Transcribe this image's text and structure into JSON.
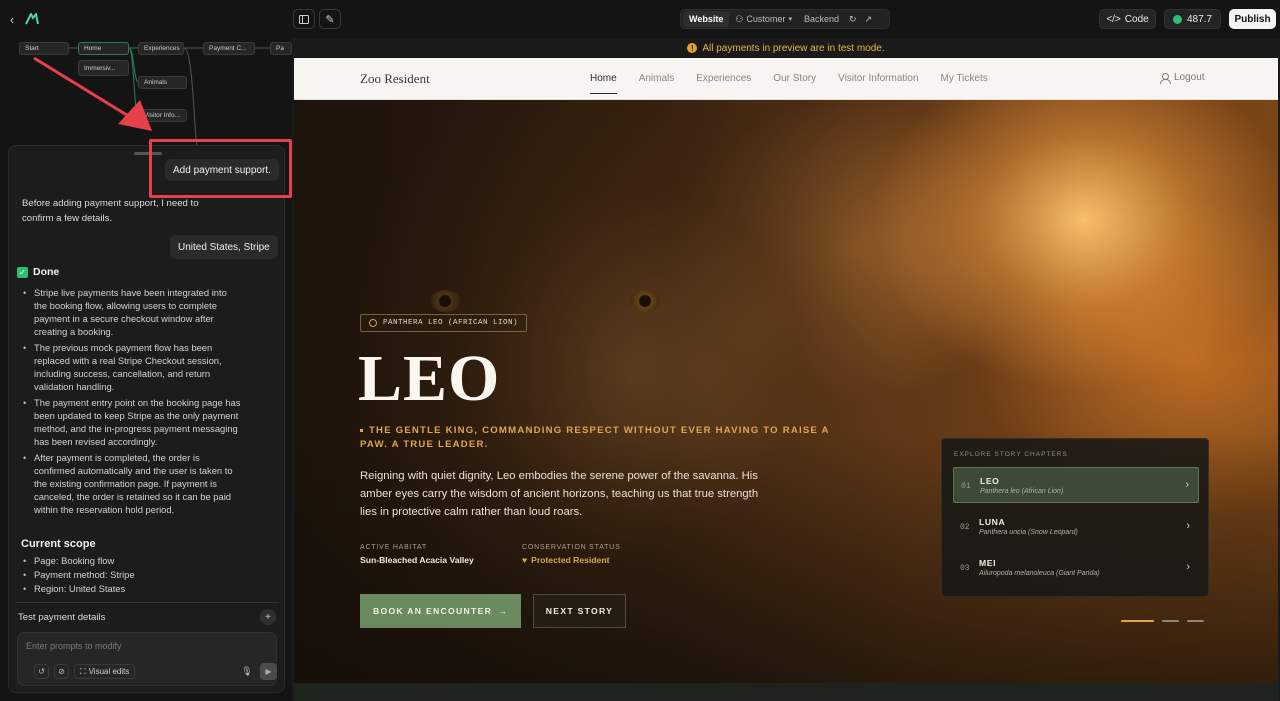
{
  "topbar": {
    "seg_website": "Website",
    "seg_customer": "Customer",
    "seg_backend": "Backend",
    "code_label": "Code",
    "credits_value": "487.7",
    "publish_label": "Publish"
  },
  "flow": {
    "nodes": [
      "Start",
      "Home",
      "Experiences",
      "Immersiv...",
      "Animals",
      "Visitor Info...",
      "Payment C...",
      "Pa"
    ]
  },
  "chat": {
    "user_message_1": "Add payment support.",
    "assistant_intro": "Before adding payment support, I need to confirm a few details.",
    "user_message_2": "United States, Stripe",
    "done_label": "Done",
    "bullets": [
      "Stripe live payments have been integrated into the booking flow, allowing users to complete payment in a secure checkout window after creating a booking.",
      "The previous mock payment flow has been replaced with a real Stripe Checkout session, including success, cancellation, and return validation handling.",
      "The payment entry point on the booking page has been updated to keep Stripe as the only payment method, and the in-progress payment messaging has been revised accordingly.",
      "After payment is completed, the order is confirmed automatically and the user is taken to the existing confirmation page. If payment is canceled, the order is retained so it can be paid within the reservation hold period."
    ],
    "scope_heading": "Current scope",
    "scope_items": [
      "Page: Booking flow",
      "Payment method: Stripe",
      "Region: United States"
    ],
    "test_details_label": "Test payment details",
    "prompt_placeholder": "Enter prompts to modify",
    "visual_edits_label": "Visual edits"
  },
  "preview": {
    "banner": "All payments in preview are in test mode.",
    "brand": "Zoo Resident",
    "nav_links": [
      "Home",
      "Animals",
      "Experiences",
      "Our Story",
      "Visitor Information",
      "My Tickets"
    ],
    "logout": "Logout",
    "species_tag": "PANTHERA LEO (AFRICAN LION)",
    "title": "LEO",
    "tagline": "THE GENTLE KING, COMMANDING RESPECT WITHOUT EVER HAVING TO RAISE A PAW. A TRUE LEADER.",
    "description": "Reigning with quiet dignity, Leo embodies the serene power of the savanna. His amber eyes carry the wisdom of ancient horizons, teaching us that true strength lies in protective calm rather than loud roars.",
    "habitat_label": "ACTIVE HABITAT",
    "habitat_value": "Sun-Bleached Acacia Valley",
    "status_label": "CONSERVATION STATUS",
    "status_value": "Protected Resident",
    "book_label": "BOOK AN ENCOUNTER",
    "next_label": "NEXT STORY",
    "chapters_heading": "EXPLORE STORY CHAPTERS",
    "chapters": [
      {
        "num": "01",
        "name": "LEO",
        "sub": "Panthera leo (African Lion)"
      },
      {
        "num": "02",
        "name": "LUNA",
        "sub": "Panthera uncia (Snow Leopard)"
      },
      {
        "num": "03",
        "name": "MEI",
        "sub": "Ailuropoda melanoleuca (Giant Panda)"
      }
    ]
  },
  "colors": {
    "accent_green": "#2fbf71",
    "highlight_red": "#e8404a",
    "warning_amber": "#e8b64c",
    "cta_green": "#6b8a5e",
    "gold": "#e0a64f"
  }
}
